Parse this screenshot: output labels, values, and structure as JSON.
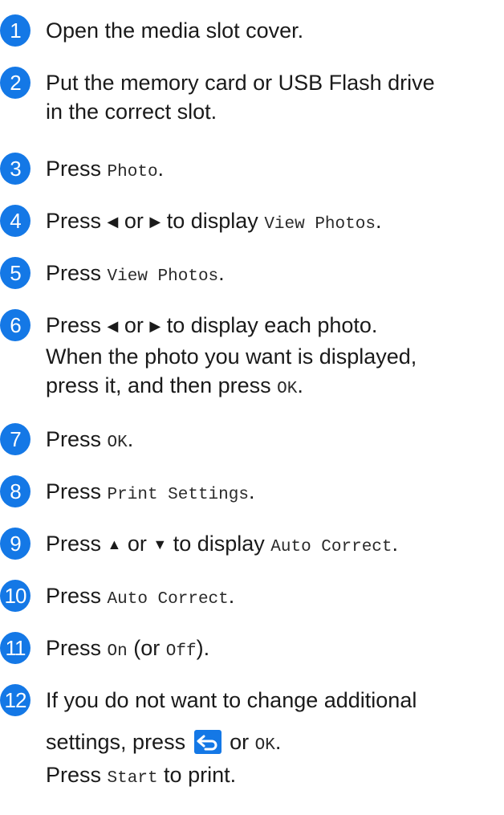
{
  "steps": [
    {
      "num": "1",
      "lines": [
        [
          "Open the media slot cover."
        ]
      ]
    },
    {
      "num": "2",
      "lines": [
        [
          "Put the memory card or USB Flash drive"
        ],
        [
          "in the correct slot."
        ]
      ]
    },
    {
      "num": "3",
      "text1": "Press ",
      "code1": "Photo",
      "text2": "."
    },
    {
      "num": "4",
      "text1": "Press ",
      "left_arrow": "◀",
      "text2": " or ",
      "right_arrow": "▶",
      "text3": " to display ",
      "code1": "View Photos",
      "text4": "."
    },
    {
      "num": "5",
      "text1": "Press ",
      "code1": "View Photos",
      "text2": "."
    },
    {
      "num": "6",
      "line1_a": "Press ",
      "left_arrow": "◀",
      "line1_b": " or ",
      "right_arrow": "▶",
      "line1_c": " to display each photo.",
      "line2": "When the photo you want is displayed,",
      "line3_a": "press it, and then press ",
      "code1": "OK",
      "line3_b": "."
    },
    {
      "num": "7",
      "text1": "Press ",
      "code1": "OK",
      "text2": "."
    },
    {
      "num": "8",
      "text1": "Press ",
      "code1": "Print Settings",
      "text2": "."
    },
    {
      "num": "9",
      "text1": "Press ",
      "up_arrow": "▲",
      "text2": " or ",
      "down_arrow": "▼",
      "text3": " to display ",
      "code1": "Auto Correct",
      "text4": "."
    },
    {
      "num": "10",
      "text1": "Press ",
      "code1": "Auto Correct",
      "text2": "."
    },
    {
      "num": "11",
      "text1": "Press ",
      "code1": "On",
      "text2": " (or ",
      "code2": "Off",
      "text3": ")."
    },
    {
      "num": "12",
      "line1": "If you do not want to change additional",
      "line2_a": "settings, press ",
      "back_icon": "back-arrow-icon",
      "line2_b": " or ",
      "code1": "OK",
      "line2_c": ".",
      "line3_code": "Start",
      "line3_text_a": "Press ",
      "line3_text_b": " to print."
    }
  ],
  "colors": {
    "badge": "#1478e6",
    "text": "#1a1a1a"
  }
}
